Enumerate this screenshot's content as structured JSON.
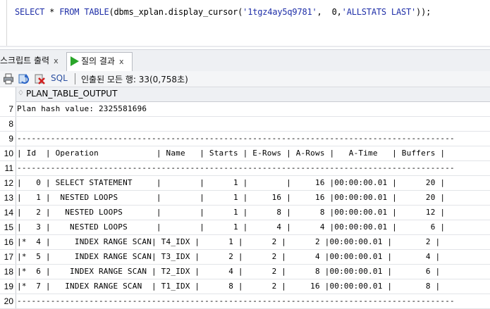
{
  "editor": {
    "sql_prefix_kw": "SELECT",
    "sql_star": " * ",
    "sql_from_kw": "FROM",
    "sql_table_kw": "TABLE",
    "sql_call": "(dbms_xplan.display_cursor(",
    "sql_arg1": "'1tgz4ay5q9781'",
    "sql_mid": ",  0,",
    "sql_arg2": "'ALLSTATS LAST'",
    "sql_end": "));"
  },
  "tabs": {
    "script_output": "스크립트 출력",
    "query_result": "질의 결과",
    "close_glyph": "x"
  },
  "toolbar": {
    "sql_label": "SQL",
    "status": "인출된 모든 행: 33(0,758초)"
  },
  "grid": {
    "column_header": "PLAN_TABLE_OUTPUT",
    "rows": [
      {
        "num": "7",
        "text": "Plan hash value: 2325581696"
      },
      {
        "num": "8",
        "text": ""
      },
      {
        "num": "9",
        "text": "-------------------------------------------------------------------------------------------"
      },
      {
        "num": "10",
        "text": "| Id  | Operation            | Name   | Starts | E-Rows | A-Rows |   A-Time   | Buffers |"
      },
      {
        "num": "11",
        "text": "-------------------------------------------------------------------------------------------"
      },
      {
        "num": "12",
        "text": "|   0 | SELECT STATEMENT     |        |      1 |        |     16 |00:00:00.01 |      20 |"
      },
      {
        "num": "13",
        "text": "|   1 |  NESTED LOOPS        |        |      1 |     16 |     16 |00:00:00.01 |      20 |"
      },
      {
        "num": "14",
        "text": "|   2 |   NESTED LOOPS       |        |      1 |      8 |      8 |00:00:00.01 |      12 |"
      },
      {
        "num": "15",
        "text": "|   3 |    NESTED LOOPS      |        |      1 |      4 |      4 |00:00:00.01 |       6 |"
      },
      {
        "num": "16",
        "text": "|*  4 |     INDEX RANGE SCAN| T4_IDX |      1 |      2 |      2 |00:00:00.01 |       2 |"
      },
      {
        "num": "17",
        "text": "|*  5 |     INDEX RANGE SCAN| T3_IDX |      2 |      2 |      4 |00:00:00.01 |       4 |"
      },
      {
        "num": "18",
        "text": "|*  6 |    INDEX RANGE SCAN | T2_IDX |      4 |      2 |      8 |00:00:00.01 |       6 |"
      },
      {
        "num": "19",
        "text": "|*  7 |   INDEX RANGE SCAN  | T1_IDX |      8 |      2 |     16 |00:00:00.01 |       8 |"
      },
      {
        "num": "20",
        "text": "-------------------------------------------------------------------------------------------"
      }
    ]
  }
}
